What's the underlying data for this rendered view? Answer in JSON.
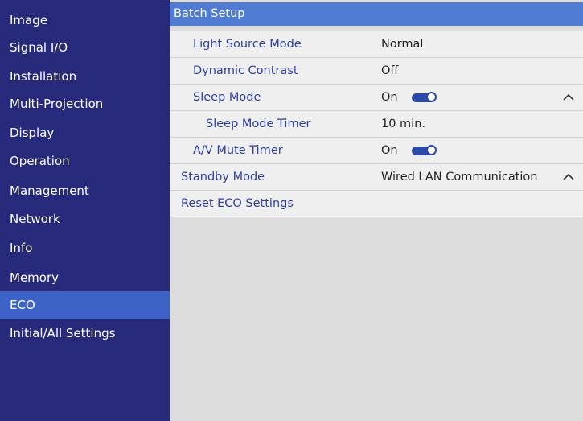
{
  "sidebar": {
    "items": [
      {
        "label": "Image"
      },
      {
        "label": "Signal I/O"
      },
      {
        "label": "Installation"
      },
      {
        "label": "Multi-Projection"
      },
      {
        "label": "Display"
      },
      {
        "label": "Operation"
      },
      {
        "label": "Management"
      },
      {
        "label": "Network"
      },
      {
        "label": "Info"
      },
      {
        "label": "Memory"
      },
      {
        "label": "ECO"
      },
      {
        "label": "Initial/All Settings"
      }
    ],
    "selected": "ECO"
  },
  "main": {
    "header": "Batch Setup",
    "rows": [
      {
        "label": "Light Source Mode",
        "value": "Normal"
      },
      {
        "label": "Dynamic Contrast",
        "value": "Off"
      },
      {
        "label": "Sleep Mode",
        "value": "On",
        "toggle": "on",
        "chevron": "chevron-up-icon"
      },
      {
        "label": "Sleep Mode Timer",
        "value": "10 min."
      },
      {
        "label": "A/V Mute Timer",
        "value": "On",
        "toggle": "on"
      },
      {
        "label": "Standby Mode",
        "value": "Wired LAN Communication",
        "chevron": "chevron-up-icon"
      },
      {
        "label": "Reset ECO Settings",
        "value": ""
      }
    ]
  },
  "colors": {
    "sidebar_bg": "#27297a",
    "sidebar_selected": "#3d62c8",
    "header_bg": "#4f7bd3",
    "label_text": "#2d3ea0",
    "toggle_on": "#2b4aa8",
    "panel_bg": "#dcdcdc"
  }
}
